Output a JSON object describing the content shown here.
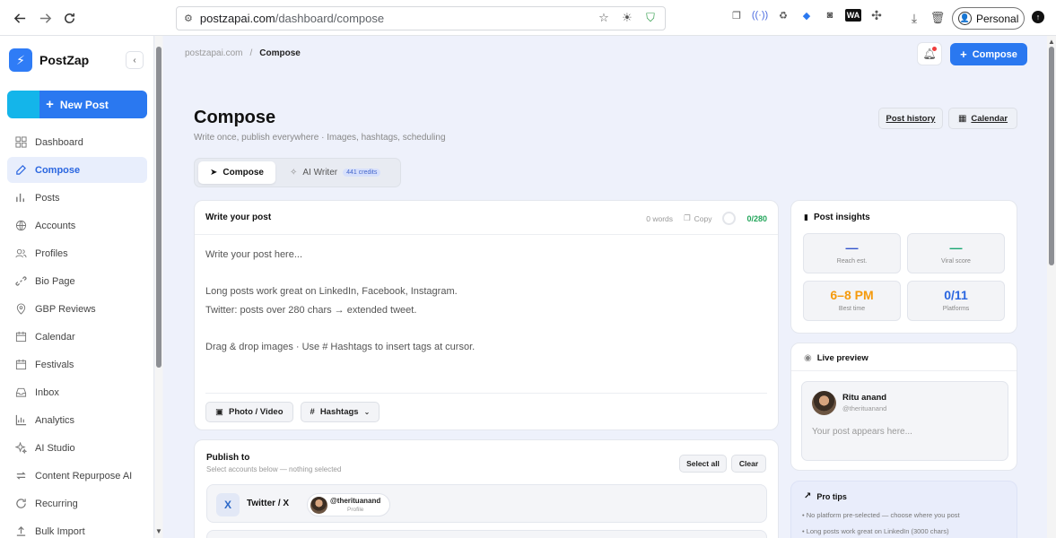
{
  "browser": {
    "url_host": "postzapai.com",
    "url_path": "/dashboard/compose",
    "profile_label": "Personal"
  },
  "sidebar": {
    "brand": "PostZap",
    "new_post_label": "New Post",
    "items": [
      {
        "label": "Dashboard",
        "icon": "grid-icon"
      },
      {
        "label": "Compose",
        "icon": "edit-icon",
        "active": true
      },
      {
        "label": "Posts",
        "icon": "bar-chart-icon"
      },
      {
        "label": "Accounts",
        "icon": "globe-icon"
      },
      {
        "label": "Profiles",
        "icon": "users-icon"
      },
      {
        "label": "Bio Page",
        "icon": "link-icon"
      },
      {
        "label": "GBP Reviews",
        "icon": "location-pin-icon"
      },
      {
        "label": "Calendar",
        "icon": "calendar-icon"
      },
      {
        "label": "Festivals",
        "icon": "calendar-icon"
      },
      {
        "label": "Inbox",
        "icon": "inbox-icon"
      },
      {
        "label": "Analytics",
        "icon": "bar-chart-icon"
      },
      {
        "label": "AI Studio",
        "icon": "sparkle-icon"
      },
      {
        "label": "Content Repurpose AI",
        "icon": "repeat-icon"
      },
      {
        "label": "Recurring",
        "icon": "refresh-icon"
      },
      {
        "label": "Bulk Import",
        "icon": "upload-icon"
      }
    ]
  },
  "topbar": {
    "breadcrumb_root": "postzapai.com",
    "breadcrumb_sep": "/",
    "breadcrumb_current": "Compose",
    "compose_label": "Compose"
  },
  "page": {
    "title": "Compose",
    "subtitle": "Write once, publish everywhere · Images, hashtags, scheduling",
    "post_history_label": "Post history",
    "calendar_label": "Calendar"
  },
  "tabs": {
    "compose": "Compose",
    "ai_writer": "AI Writer",
    "credits": "441 credits"
  },
  "editor": {
    "title": "Write your post",
    "words": "0 words",
    "copy_label": "Copy",
    "char_count": "0/280",
    "lines": [
      "Write your post here...",
      "",
      "Long posts work great on LinkedIn, Facebook, Instagram.",
      "Twitter: posts over 280 chars → extended tweet.",
      "",
      "Drag & drop images · Use # Hashtags to insert tags at cursor."
    ],
    "photo_video_label": "Photo / Video",
    "hashtags_label": "Hashtags"
  },
  "publish": {
    "title": "Publish to",
    "subtitle": "Select accounts below — nothing selected",
    "select_all_label": "Select all",
    "clear_label": "Clear",
    "account_platform": "Twitter / X",
    "account_badge": "X",
    "account_handle": "@therituanand",
    "account_type": "Profile"
  },
  "insights": {
    "title": "Post insights",
    "metrics": [
      {
        "value": "—",
        "label": "Reach est.",
        "color": "#3355cc"
      },
      {
        "value": "—",
        "label": "Viral score",
        "color": "#1aa772"
      },
      {
        "value": "6–8 PM",
        "label": "Best time",
        "color": "#f59a0c"
      },
      {
        "value": "0/11",
        "label": "Platforms",
        "color": "#2a66e0"
      }
    ]
  },
  "preview": {
    "title": "Live preview",
    "name": "Ritu anand",
    "handle": "@therituanand",
    "placeholder": "Your post appears here..."
  },
  "tips": {
    "title": "Pro tips",
    "items": [
      "No platform pre-selected — choose where you post",
      "Long posts work great on LinkedIn (3000 chars)"
    ]
  }
}
